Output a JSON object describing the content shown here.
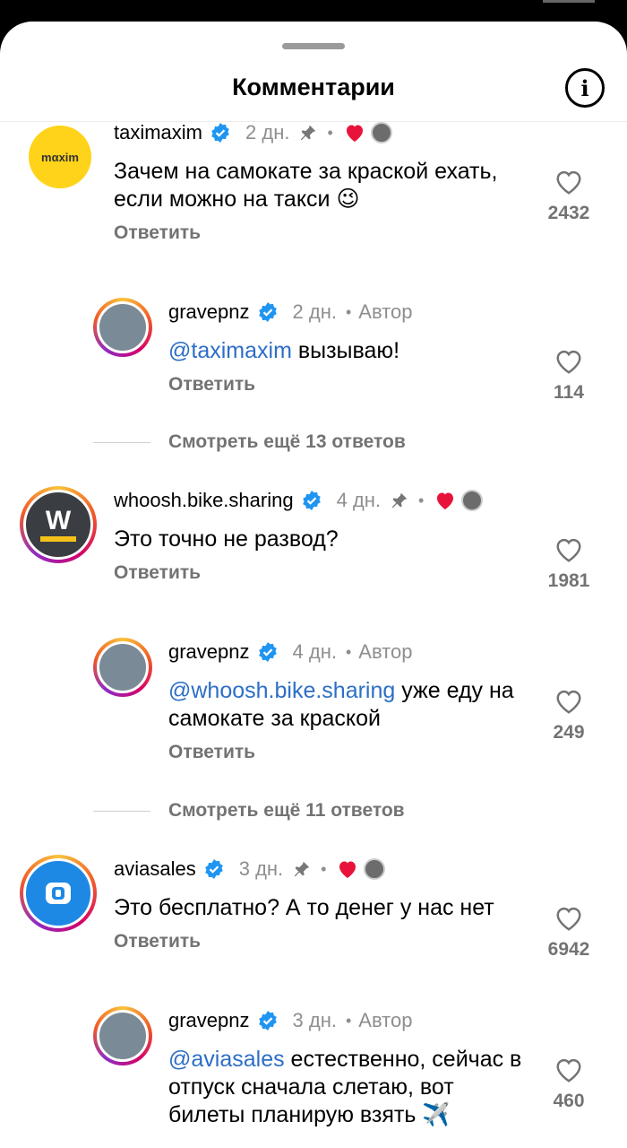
{
  "sheet": {
    "title": "Комментарии"
  },
  "comments": [
    {
      "username": "taximaxim",
      "time": "2 дн.",
      "text": "Зачем на самокате за краской ехать, если можно на такси 😉",
      "reply_label": "Ответить",
      "likes": "2432",
      "avatar_label": "mαxim"
    },
    {
      "username": "gravepnz",
      "time": "2 дн.",
      "author_label": "Автор",
      "mention": "@taximaxim",
      "text_rest": " вызываю!",
      "reply_label": "Ответить",
      "likes": "114"
    },
    {
      "view_more": "Смотреть ещё 13 ответов"
    },
    {
      "username": "whoosh.bike.sharing",
      "time": "4 дн.",
      "text": "Это точно не развод?",
      "reply_label": "Ответить",
      "likes": "1981",
      "avatar_label": "W"
    },
    {
      "username": "gravepnz",
      "time": "4 дн.",
      "author_label": "Автор",
      "mention": "@whoosh.bike.sharing",
      "text_rest": " уже еду на самокате за краской",
      "reply_label": "Ответить",
      "likes": "249"
    },
    {
      "view_more": "Смотреть ещё 11 ответов"
    },
    {
      "username": "aviasales",
      "time": "3 дн.",
      "text": "Это бесплатно? А то денег у нас нет",
      "reply_label": "Ответить",
      "likes": "6942"
    },
    {
      "username": "gravepnz",
      "time": "3 дн.",
      "author_label": "Автор",
      "mention": "@aviasales",
      "text_rest": " естественно, сейчас в отпуск сначала слетаю, вот билеты планирую взять ✈️",
      "likes": "460"
    }
  ],
  "dot": "•",
  "colors": {
    "mention": "#2c6ec7",
    "verified": "#1f95f2",
    "liked_heart": "#e8133a",
    "maxim_bg": "#ffd31a",
    "whoosh_bg": "#3a3d42",
    "whoosh_accent": "#f5c21a",
    "aviasales_bg": "#1e88e5"
  },
  "icons": {
    "info": "info-icon",
    "verified": "verified-badge-icon",
    "pin": "pin-icon",
    "heart": "heart-outline-icon",
    "liked": "heart-filled-icon"
  }
}
